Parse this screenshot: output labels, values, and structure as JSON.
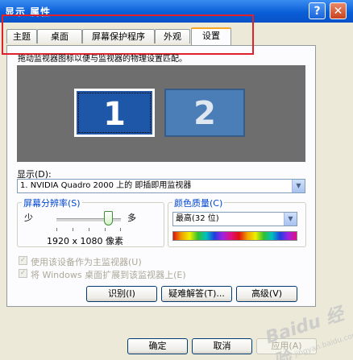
{
  "window": {
    "title": "显示 属性",
    "help_label": "?",
    "close_label": "✕"
  },
  "tabs": [
    {
      "label": "主题"
    },
    {
      "label": "桌面"
    },
    {
      "label": "屏幕保护程序"
    },
    {
      "label": "外观"
    },
    {
      "label": "设置"
    }
  ],
  "active_tab": "设置",
  "hint": "拖动监视器图标以便与监视器的物理设置匹配。",
  "monitors": [
    {
      "label": "1"
    },
    {
      "label": "2"
    }
  ],
  "display": {
    "label": "显示(D):",
    "value": "1. NVIDIA Quadro 2000 上的 即插即用监视器"
  },
  "resolution": {
    "group_label": "屏幕分辨率(S)",
    "min_label": "少",
    "max_label": "多",
    "value_text": "1920 x 1080 像素",
    "slider_level": 0.8
  },
  "color_quality": {
    "group_label": "颜色质量(C)",
    "value": "最高(32 位)"
  },
  "checkboxes": [
    {
      "label": "使用该设备作为主监视器(U)",
      "checked": true
    },
    {
      "label": "将 Windows 桌面扩展到该监视器上(E)",
      "checked": true
    }
  ],
  "panel_buttons": {
    "identify": "识别(I)",
    "troubleshoot": "疑难解答(T)...",
    "advanced": "高级(V)"
  },
  "dialog_buttons": {
    "ok": "确定",
    "cancel": "取消",
    "apply": "应用(A)"
  },
  "watermark": {
    "brand": "Baidu 经验",
    "url": "jingyan.baidu.com"
  },
  "colors": {
    "highlight_box": "#e0202a",
    "titlebar": "#0a5fd8",
    "monitor_selected": "#1e56a8"
  }
}
